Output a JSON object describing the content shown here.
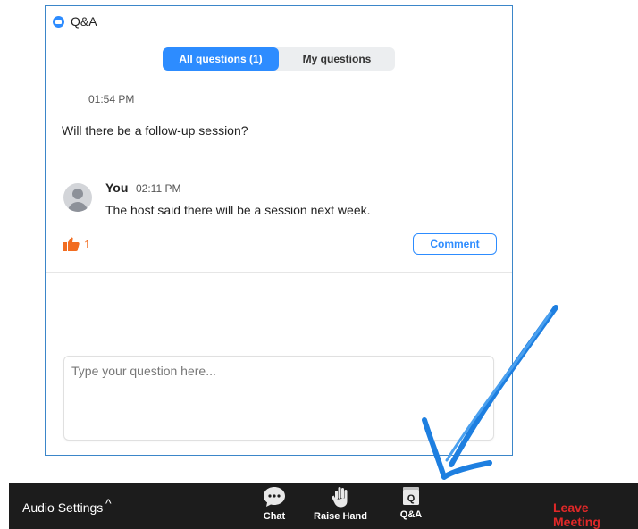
{
  "qa_window": {
    "title": "Q&A",
    "tabs": [
      {
        "label": "All questions  (1)",
        "active": true
      },
      {
        "label": "My questions",
        "active": false
      }
    ],
    "question": {
      "time": "01:54 PM",
      "text": "Will there be a follow-up session?"
    },
    "answer": {
      "author": "You",
      "time": "02:11 PM",
      "text": "The host said there will be a session next week."
    },
    "likes": "1",
    "comment_label": "Comment",
    "input_placeholder": "Type your question here..."
  },
  "toolbar": {
    "audio_settings": "Audio Settings",
    "caret_icon": "^",
    "chat_label": "Chat",
    "raise_hand_label": "Raise Hand",
    "qa_label": "Q&A",
    "qa_icon_letter": "Q",
    "leave_label": "Leave Meeting"
  },
  "colors": {
    "accent": "#2d8cff",
    "like": "#f26d21",
    "leave": "#e02828",
    "toolbar_bg": "#1c1c1c",
    "annotation_arrow": "#1e7fe0"
  }
}
